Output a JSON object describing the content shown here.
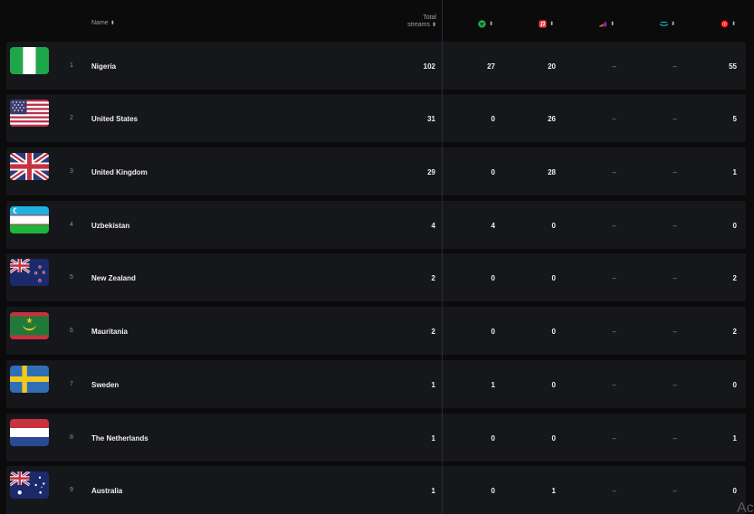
{
  "header": {
    "name_label": "Name",
    "total_label_line1": "Total",
    "total_label_line2": "streams",
    "sort_glyph": "⬍"
  },
  "platforms": [
    {
      "icon": "spotify-icon",
      "color": "#1db954"
    },
    {
      "icon": "apple-music-icon",
      "color": "#fc3c44"
    },
    {
      "icon": "deezer-icon",
      "color": "#a238ff"
    },
    {
      "icon": "amazon-music-icon",
      "color": "#25d1da"
    },
    {
      "icon": "youtube-music-icon",
      "color": "#ff0000"
    }
  ],
  "rows": [
    {
      "rank": "1",
      "country": "Nigeria",
      "flag": "nigeria",
      "total": "102",
      "spotify": "27",
      "apple": "20",
      "deezer": "–",
      "amazon": "–",
      "youtube": "55"
    },
    {
      "rank": "2",
      "country": "United States",
      "flag": "usa",
      "total": "31",
      "spotify": "0",
      "apple": "26",
      "deezer": "–",
      "amazon": "–",
      "youtube": "5"
    },
    {
      "rank": "3",
      "country": "United Kingdom",
      "flag": "uk",
      "total": "29",
      "spotify": "0",
      "apple": "28",
      "deezer": "–",
      "amazon": "–",
      "youtube": "1"
    },
    {
      "rank": "4",
      "country": "Uzbekistan",
      "flag": "uzbekistan",
      "total": "4",
      "spotify": "4",
      "apple": "0",
      "deezer": "–",
      "amazon": "–",
      "youtube": "0"
    },
    {
      "rank": "5",
      "country": "New Zealand",
      "flag": "newzealand",
      "total": "2",
      "spotify": "0",
      "apple": "0",
      "deezer": "–",
      "amazon": "–",
      "youtube": "2"
    },
    {
      "rank": "6",
      "country": "Mauritania",
      "flag": "mauritania",
      "total": "2",
      "spotify": "0",
      "apple": "0",
      "deezer": "–",
      "amazon": "–",
      "youtube": "2"
    },
    {
      "rank": "7",
      "country": "Sweden",
      "flag": "sweden",
      "total": "1",
      "spotify": "1",
      "apple": "0",
      "deezer": "–",
      "amazon": "–",
      "youtube": "0"
    },
    {
      "rank": "8",
      "country": "The Netherlands",
      "flag": "netherlands",
      "total": "1",
      "spotify": "0",
      "apple": "0",
      "deezer": "–",
      "amazon": "–",
      "youtube": "1"
    },
    {
      "rank": "9",
      "country": "Australia",
      "flag": "australia",
      "total": "1",
      "spotify": "0",
      "apple": "1",
      "deezer": "–",
      "amazon": "–",
      "youtube": "0"
    }
  ],
  "overlay_text": "Ac"
}
